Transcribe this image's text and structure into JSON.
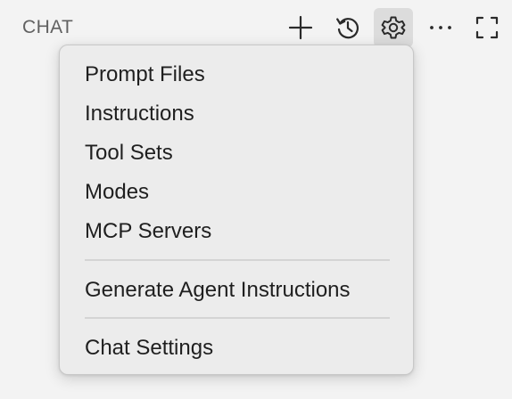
{
  "header": {
    "title": "CHAT",
    "actions": [
      {
        "name": "new-chat",
        "icon": "plus-icon"
      },
      {
        "name": "history",
        "icon": "history-icon"
      },
      {
        "name": "settings",
        "icon": "gear-icon",
        "active": true
      },
      {
        "name": "more-actions",
        "icon": "ellipsis-icon"
      },
      {
        "name": "maximize",
        "icon": "maximize-icon"
      }
    ]
  },
  "menu": {
    "groups": [
      {
        "items": [
          {
            "label": "Prompt Files"
          },
          {
            "label": "Instructions"
          },
          {
            "label": "Tool Sets"
          },
          {
            "label": "Modes"
          },
          {
            "label": "MCP Servers"
          }
        ]
      },
      {
        "items": [
          {
            "label": "Generate Agent Instructions"
          }
        ]
      },
      {
        "items": [
          {
            "label": "Chat Settings"
          }
        ]
      }
    ]
  },
  "colors": {
    "background": "#f3f3f3",
    "menu_background": "#ececec",
    "active_button": "#dcdcdc",
    "text": "#1f1f1f",
    "muted_text": "#616161"
  }
}
